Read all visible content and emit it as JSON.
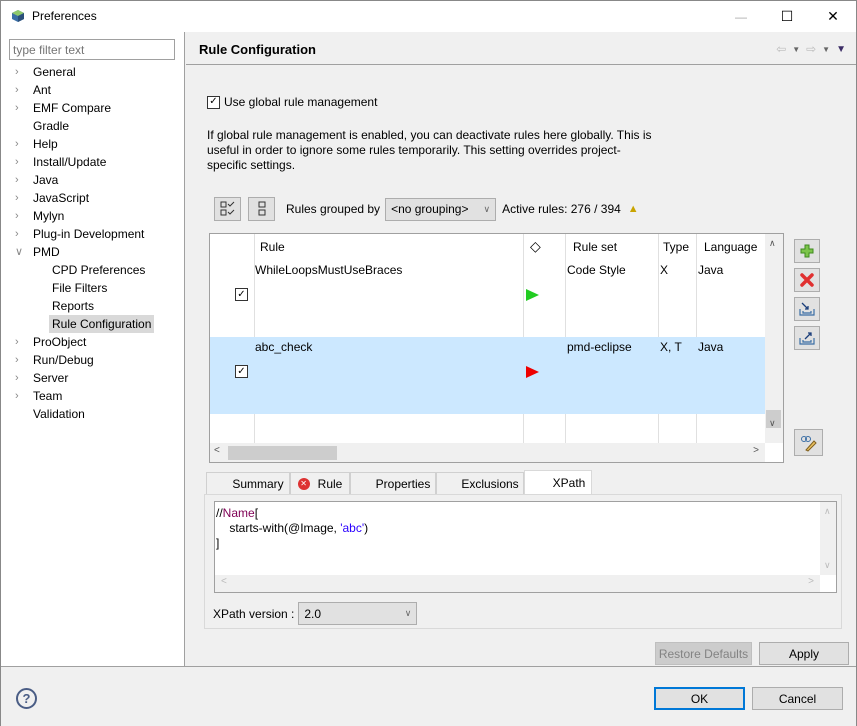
{
  "window": {
    "title": "Preferences",
    "controls": {
      "minimize": "—",
      "maximize": "☐",
      "close": "✕"
    }
  },
  "sidebar": {
    "filter_placeholder": "type filter text",
    "items": [
      {
        "label": "General",
        "expander": "collapsed"
      },
      {
        "label": "Ant",
        "expander": "collapsed"
      },
      {
        "label": "EMF Compare",
        "expander": "collapsed"
      },
      {
        "label": "Gradle",
        "expander": "none"
      },
      {
        "label": "Help",
        "expander": "collapsed"
      },
      {
        "label": "Install/Update",
        "expander": "collapsed"
      },
      {
        "label": "Java",
        "expander": "collapsed"
      },
      {
        "label": "JavaScript",
        "expander": "collapsed"
      },
      {
        "label": "Mylyn",
        "expander": "collapsed"
      },
      {
        "label": "Plug-in Development",
        "expander": "collapsed"
      },
      {
        "label": "PMD",
        "expander": "expanded"
      },
      {
        "label": "CPD Preferences",
        "child": true
      },
      {
        "label": "File Filters",
        "child": true
      },
      {
        "label": "Reports",
        "child": true
      },
      {
        "label": "Rule Configuration",
        "child": true,
        "selected": true
      },
      {
        "label": "ProObject",
        "expander": "collapsed"
      },
      {
        "label": "Run/Debug",
        "expander": "collapsed"
      },
      {
        "label": "Server",
        "expander": "collapsed"
      },
      {
        "label": "Team",
        "expander": "collapsed"
      },
      {
        "label": "Validation",
        "expander": "none"
      }
    ]
  },
  "page": {
    "title": "Rule Configuration",
    "global_checkbox": {
      "label": "Use global rule management",
      "checked": true
    },
    "description": "If global rule management is enabled, you can deactivate rules here globally. This is useful in order to ignore some rules temporarily. This setting overrides project-specific settings.",
    "toolbar": {
      "grouped_by_label": "Rules grouped by",
      "grouping_value": "<no grouping>",
      "active_rules": "Active rules: 276 / 394",
      "warning_icon": "warning-icon"
    },
    "table": {
      "columns": [
        "",
        "Rule",
        "◇",
        "Rule set",
        "Type",
        "Language"
      ],
      "rows": [
        {
          "checked": true,
          "rule": "WhileLoopsMustUseBraces",
          "priority_color": "#22cc22",
          "ruleset": "Code Style",
          "type": "X",
          "language": "Java",
          "selected": false
        },
        {
          "checked": true,
          "rule": "abc_check",
          "priority_color": "#ee0000",
          "ruleset": "pmd-eclipse",
          "type": "X, T",
          "language": "Java",
          "selected": true
        }
      ]
    },
    "side_buttons": [
      "add-rule",
      "remove-rule",
      "import-rules",
      "export-rules",
      "edit-rule-xpath"
    ],
    "tabs": [
      {
        "label": "Summary",
        "active": false
      },
      {
        "label": "Rule",
        "active": false,
        "icon": "error-icon"
      },
      {
        "label": "Properties",
        "active": false
      },
      {
        "label": "Exclusions",
        "active": false
      },
      {
        "label": "XPath",
        "active": true
      }
    ],
    "xpath": {
      "line1_prefix": "//",
      "line1_name": "Name",
      "line1_suffix": "[",
      "line2_prefix": "    starts-with(@Image, ",
      "line2_string": "'abc'",
      "line2_suffix": ")",
      "line3": "]",
      "version_label": "XPath version :",
      "version_value": "2.0"
    },
    "restore_defaults": "Restore Defaults",
    "apply": "Apply"
  },
  "footer": {
    "help": "?",
    "ok": "OK",
    "cancel": "Cancel"
  }
}
